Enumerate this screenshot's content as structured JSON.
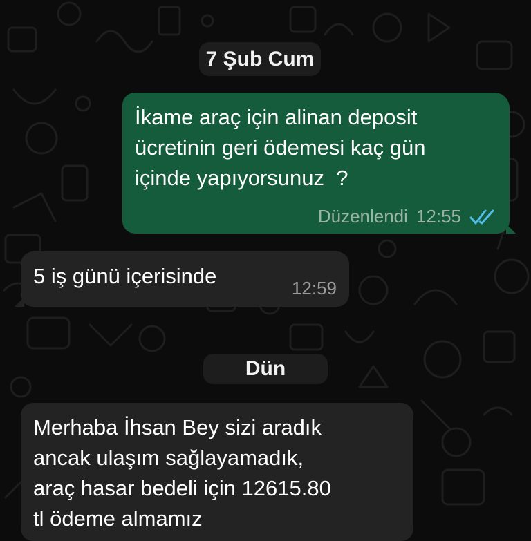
{
  "chat": {
    "date_separators": [
      "7 Şub Cum",
      "Dün"
    ],
    "messages": [
      {
        "direction": "outgoing",
        "lines": [
          "İkame araç için alinan deposit",
          "ücretinin geri ödemesi kaç gün",
          "içinde yapıyorsunuz  ?"
        ],
        "edited_label": "Düzenlendi",
        "time": "12:55",
        "status": "read"
      },
      {
        "direction": "incoming",
        "lines": [
          "5 iş günü içerisinde"
        ],
        "time": "12:59"
      },
      {
        "direction": "incoming",
        "lines": [
          "Merhaba İhsan Bey sizi aradık",
          "ancak ulaşım sağlayamadık,",
          "araç hasar bedeli için 12615.80",
          "tl ödeme almamız"
        ]
      }
    ]
  },
  "colors": {
    "background": "#0c0c0c",
    "outgoing_bubble": "#155c3c",
    "incoming_bubble": "#232323",
    "date_chip": "#1d1d1d",
    "read_ticks": "#53bdeb"
  },
  "icons": {
    "read_status": "double-check-icon"
  }
}
